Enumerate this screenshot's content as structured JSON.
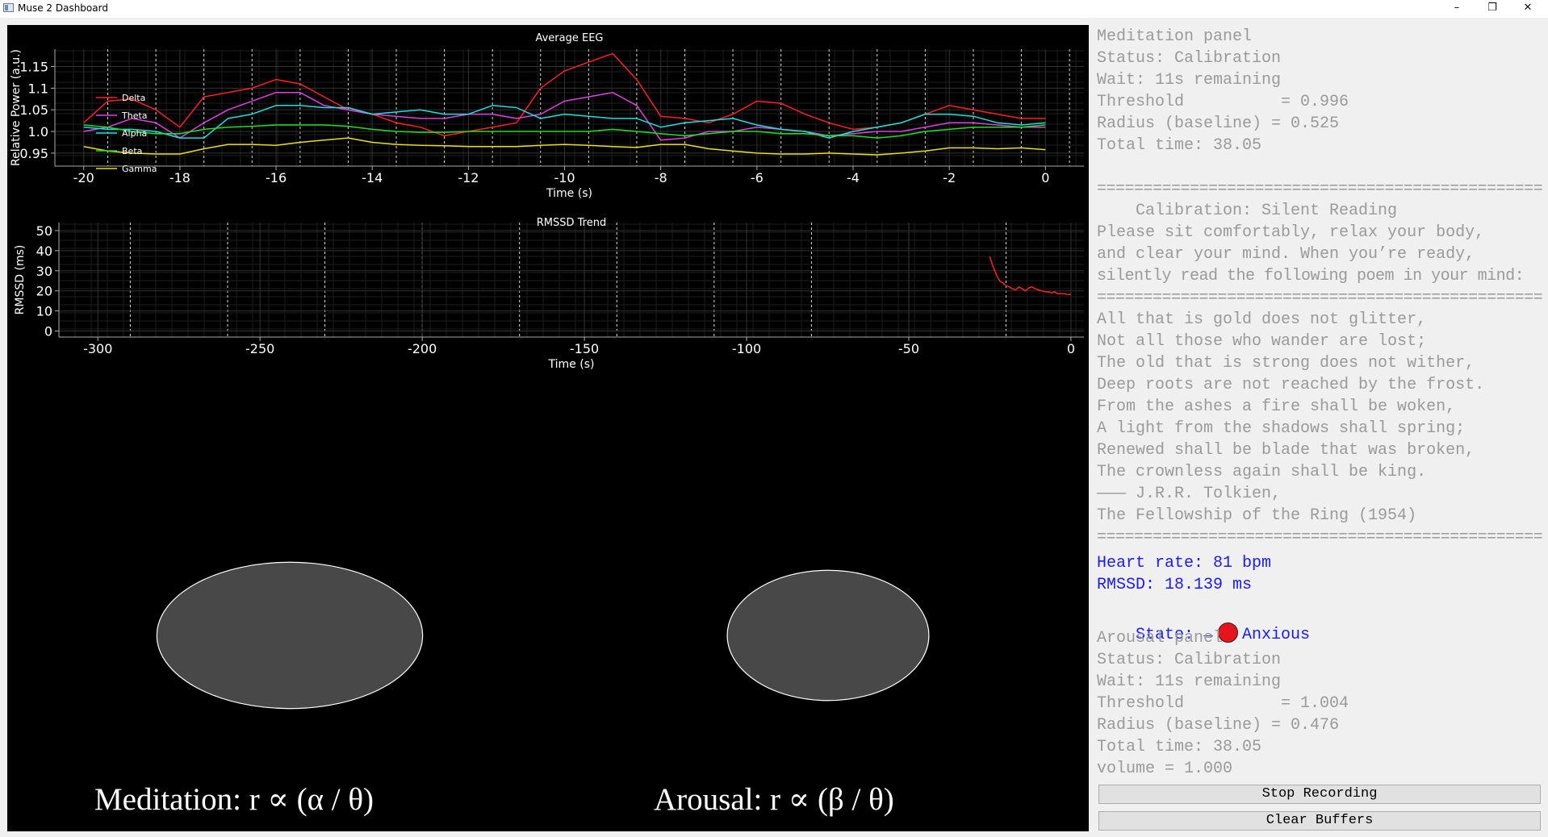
{
  "window": {
    "title": "Muse 2 Dashboard",
    "minimize": "–",
    "restore": "❐",
    "close": "✕",
    "icon": "app-window-icon"
  },
  "eeg_chart": {
    "title": "Average EEG",
    "xlabel": "Time (s)",
    "ylabel": "Relative Power (a.u.)",
    "x_ticks": [
      "-20",
      "-18",
      "-16",
      "-14",
      "-12",
      "-10",
      "-8",
      "-6",
      "-4",
      "-2",
      "0"
    ],
    "y_ticks": [
      "1.15",
      "1.1",
      "1.05",
      "1.0",
      "0.95"
    ]
  },
  "rmssd_chart": {
    "title": "RMSSD Trend",
    "xlabel": "Time (s)",
    "ylabel": "RMSSD (ms)",
    "x_ticks": [
      "-300",
      "-250",
      "-200",
      "-150",
      "-100",
      "-50",
      "0"
    ],
    "y_ticks": [
      "50",
      "40",
      "30",
      "20",
      "10",
      "0"
    ]
  },
  "chart_data": [
    {
      "type": "line",
      "title": "Average EEG",
      "xlabel": "Time (s)",
      "ylabel": "Relative Power (a.u.)",
      "xlim": [
        -20.6,
        0.8
      ],
      "ylim": [
        0.92,
        1.19
      ],
      "grid": true,
      "legend": "top-left",
      "x": [
        -20,
        -19.5,
        -19,
        -18.5,
        -18,
        -17.5,
        -17,
        -16.5,
        -16,
        -15.5,
        -15,
        -14.5,
        -14,
        -13.5,
        -13,
        -12.5,
        -12,
        -11.5,
        -11,
        -10.5,
        -10,
        -9.5,
        -9,
        -8.5,
        -8,
        -7.5,
        -7,
        -6.5,
        -6,
        -5.5,
        -5,
        -4.5,
        -4,
        -3.5,
        -3,
        -2.5,
        -2,
        -1.5,
        -1,
        -0.5,
        0
      ],
      "series": [
        {
          "name": "Delta",
          "color": "#ff2020",
          "values": [
            1.02,
            1.07,
            1.075,
            1.05,
            1.01,
            1.08,
            1.09,
            1.1,
            1.12,
            1.11,
            1.08,
            1.05,
            1.04,
            1.02,
            1.01,
            0.99,
            1.0,
            1.01,
            1.02,
            1.1,
            1.14,
            1.16,
            1.18,
            1.12,
            1.035,
            1.03,
            1.02,
            1.04,
            1.07,
            1.065,
            1.04,
            1.02,
            1.005,
            1.01,
            1.02,
            1.04,
            1.06,
            1.05,
            1.04,
            1.03,
            1.03
          ]
        },
        {
          "name": "Theta",
          "color": "#e040e0",
          "values": [
            1.0,
            1.01,
            1.03,
            1.02,
            0.985,
            1.02,
            1.05,
            1.07,
            1.09,
            1.09,
            1.06,
            1.05,
            1.04,
            1.035,
            1.03,
            1.03,
            1.04,
            1.04,
            1.03,
            1.04,
            1.07,
            1.08,
            1.09,
            1.06,
            0.98,
            0.985,
            1.0,
            1.0,
            1.01,
            1.005,
            1.0,
            0.99,
            0.995,
            1.0,
            1.0,
            1.01,
            1.02,
            1.02,
            1.015,
            1.01,
            1.01
          ]
        },
        {
          "name": "Alpha",
          "color": "#20e0e0",
          "values": [
            1.01,
            1.005,
            1.005,
            1.0,
            0.985,
            0.985,
            1.03,
            1.04,
            1.06,
            1.06,
            1.055,
            1.055,
            1.04,
            1.045,
            1.05,
            1.04,
            1.04,
            1.06,
            1.055,
            1.03,
            1.04,
            1.035,
            1.03,
            1.03,
            1.01,
            1.02,
            1.025,
            1.03,
            1.015,
            1.005,
            1.0,
            0.985,
            1.0,
            1.01,
            1.02,
            1.04,
            1.04,
            1.035,
            1.02,
            1.015,
            1.02
          ]
        },
        {
          "name": "Beta",
          "color": "#20e020",
          "values": [
            1.015,
            1.01,
            1.0,
            0.995,
            0.995,
            1.005,
            1.01,
            1.012,
            1.015,
            1.015,
            1.015,
            1.012,
            1.005,
            1.0,
            0.998,
            0.998,
            1.0,
            1.0,
            1.0,
            1.0,
            1.0,
            1.0,
            1.005,
            1.0,
            0.995,
            0.99,
            0.995,
            1.0,
            1.0,
            0.995,
            0.995,
            0.99,
            0.99,
            0.985,
            0.99,
            1.0,
            1.005,
            1.01,
            1.01,
            1.01,
            1.015
          ]
        },
        {
          "name": "Gamma",
          "color": "#e8e020",
          "values": [
            0.965,
            0.955,
            0.95,
            0.948,
            0.948,
            0.96,
            0.97,
            0.97,
            0.968,
            0.975,
            0.98,
            0.985,
            0.975,
            0.97,
            0.968,
            0.967,
            0.965,
            0.965,
            0.965,
            0.968,
            0.97,
            0.968,
            0.965,
            0.963,
            0.97,
            0.97,
            0.96,
            0.955,
            0.95,
            0.948,
            0.948,
            0.95,
            0.948,
            0.946,
            0.95,
            0.955,
            0.962,
            0.962,
            0.96,
            0.962,
            0.958
          ]
        }
      ]
    },
    {
      "type": "line",
      "title": "RMSSD Trend",
      "xlabel": "Time (s)",
      "ylabel": "RMSSD (ms)",
      "xlim": [
        -312,
        4
      ],
      "ylim": [
        -3,
        54
      ],
      "grid": true,
      "series": [
        {
          "name": "RMSSD",
          "color": "#ff2020",
          "x": [
            -25,
            -24,
            -23,
            -22,
            -21,
            -20,
            -19,
            -18,
            -17,
            -16,
            -15,
            -14,
            -13,
            -12,
            -11,
            -10,
            -9,
            -8,
            -7,
            -6,
            -5,
            -4,
            -3,
            -2,
            -1,
            0
          ],
          "values": [
            37,
            32,
            28,
            25,
            24,
            22.5,
            22,
            21,
            20.5,
            22,
            21,
            20,
            21.5,
            22,
            21,
            20.5,
            20,
            19.5,
            19.5,
            19,
            19.5,
            18.5,
            18.7,
            18.5,
            18.2,
            18.3
          ]
        }
      ]
    }
  ],
  "indicators": {
    "meditation_radius": 0.525,
    "arousal_radius": 0.476,
    "fill": "#484848",
    "edge": "#ffffff"
  },
  "formulas": {
    "meditation": "Meditation: r ∝ (α / θ)",
    "arousal": "Arousal: r ∝ (β / θ)"
  },
  "meditation_panel": {
    "title": "Meditation panel",
    "status": "Status: Calibration",
    "wait": "Wait: 11s remaining",
    "threshold": "Threshold          = 0.996",
    "radius": "Radius (baseline) = 0.525",
    "total": "Total time: 38.05"
  },
  "separator": "================================================",
  "calibration": {
    "heading": "    Calibration: Silent Reading",
    "instructions": [
      "Please sit comfortably, relax your body,",
      "and clear your mind. When you’re ready,",
      "silently read the following poem in your mind:"
    ]
  },
  "poem": [
    "All that is gold does not glitter,",
    "Not all those who wander are lost;",
    "The old that is strong does not wither,",
    "Deep roots are not reached by the frost.",
    "From the ashes a fire shall be woken,",
    "A light from the shadows shall spring;",
    "Renewed shall be blade that was broken,",
    "The crownless again shall be king.",
    "——— J.R.R. Tolkien,",
    "The Fellowship of the Ring (1954)"
  ],
  "vitals": {
    "heart_rate": "Heart rate: 81 bpm",
    "rmssd": "RMSSD: 18.139 ms",
    "state_label": "State: →",
    "state_value": "Anxious",
    "state_color": "#e8141c"
  },
  "arousal_panel": {
    "title": "Arousal panel",
    "status": "Status: Calibration",
    "wait": "Wait: 11s remaining",
    "threshold": "Threshold          = 1.004",
    "radius": "Radius (baseline) = 0.476",
    "total": "Total time: 38.05",
    "volume": "volume = 1.000"
  },
  "buttons": {
    "stop": "Stop Recording",
    "clear": "Clear Buffers"
  }
}
